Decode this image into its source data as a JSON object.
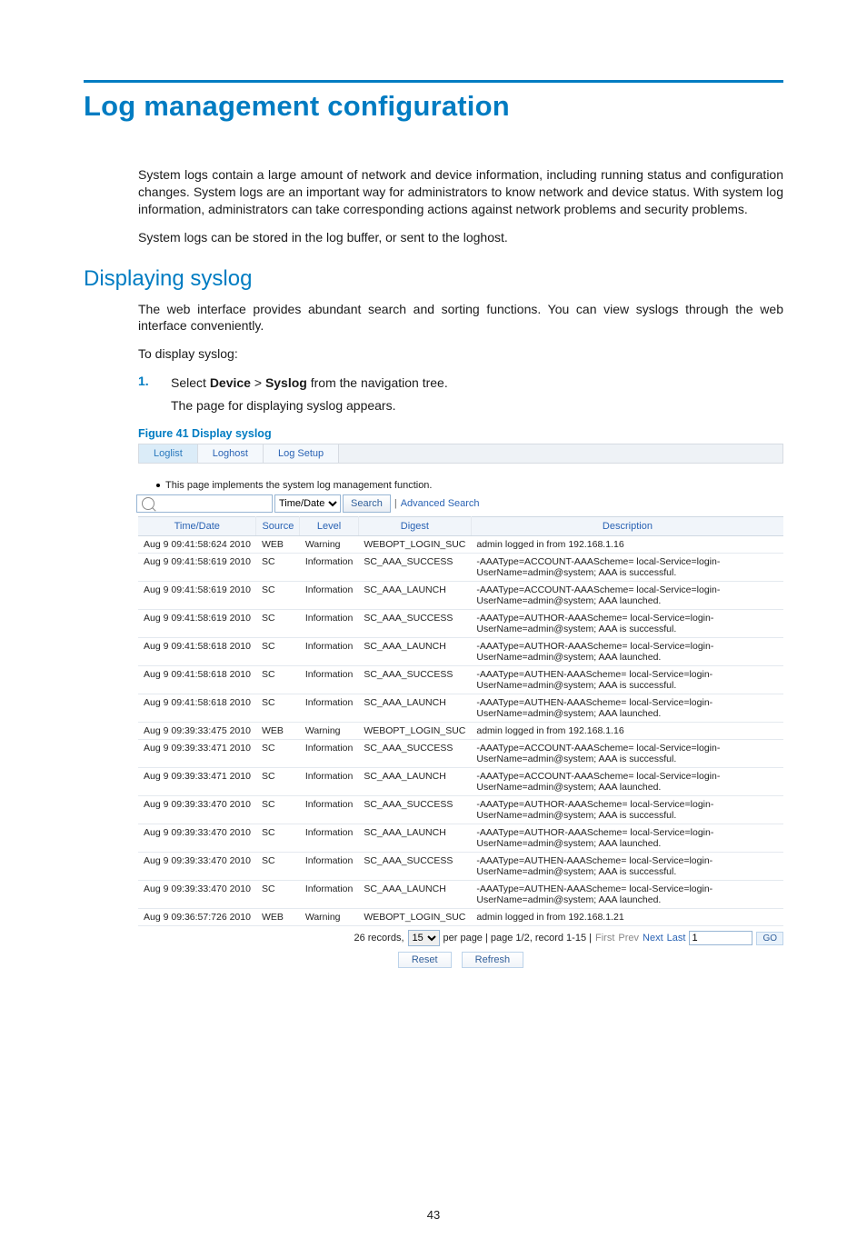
{
  "page_number": "43",
  "title": "Log management configuration",
  "intro_paragraphs": [
    "System logs contain a large amount of network and device information, including running status and configuration changes. System logs are an important way for administrators to know network and device status. With system log information, administrators can take corresponding actions against network problems and security problems.",
    "System logs can be stored in the log buffer, or sent to the loghost."
  ],
  "section_heading": "Displaying syslog",
  "section_paragraphs": [
    "The web interface provides abundant search and sorting functions. You can view syslogs through the web interface conveniently.",
    "To display syslog:"
  ],
  "step": {
    "num": "1.",
    "prefix": "Select ",
    "bold1": "Device",
    "gt": " > ",
    "bold2": "Syslog",
    "suffix": " from the navigation tree.",
    "subtext": "The page for displaying syslog appears."
  },
  "figure_caption": "Figure 41 Display syslog",
  "ui": {
    "tabs": {
      "loglist": "Loglist",
      "loghost": "Loghost",
      "log_setup": "Log Setup"
    },
    "note": "This page implements the system log management function.",
    "search": {
      "value": "",
      "criteria": "Time/Date",
      "button": "Search",
      "advanced": "Advanced Search"
    },
    "columns": {
      "time": "Time/Date",
      "source": "Source",
      "level": "Level",
      "digest": "Digest",
      "description": "Description"
    },
    "rows": [
      {
        "time": "Aug  9 09:41:58:624 2010",
        "source": "WEB",
        "level": "Warning",
        "digest": "WEBOPT_LOGIN_SUC",
        "description": "admin logged in from 192.168.1.16"
      },
      {
        "time": "Aug  9 09:41:58:619 2010",
        "source": "SC",
        "level": "Information",
        "digest": "SC_AAA_SUCCESS",
        "description": "-AAAType=ACCOUNT-AAAScheme= local-Service=login-UserName=admin@system; AAA is successful."
      },
      {
        "time": "Aug  9 09:41:58:619 2010",
        "source": "SC",
        "level": "Information",
        "digest": "SC_AAA_LAUNCH",
        "description": "-AAAType=ACCOUNT-AAAScheme= local-Service=login-UserName=admin@system; AAA launched."
      },
      {
        "time": "Aug  9 09:41:58:619 2010",
        "source": "SC",
        "level": "Information",
        "digest": "SC_AAA_SUCCESS",
        "description": "-AAAType=AUTHOR-AAAScheme= local-Service=login-UserName=admin@system; AAA is successful."
      },
      {
        "time": "Aug  9 09:41:58:618 2010",
        "source": "SC",
        "level": "Information",
        "digest": "SC_AAA_LAUNCH",
        "description": "-AAAType=AUTHOR-AAAScheme= local-Service=login-UserName=admin@system; AAA launched."
      },
      {
        "time": "Aug  9 09:41:58:618 2010",
        "source": "SC",
        "level": "Information",
        "digest": "SC_AAA_SUCCESS",
        "description": "-AAAType=AUTHEN-AAAScheme= local-Service=login-UserName=admin@system; AAA is successful."
      },
      {
        "time": "Aug  9 09:41:58:618 2010",
        "source": "SC",
        "level": "Information",
        "digest": "SC_AAA_LAUNCH",
        "description": "-AAAType=AUTHEN-AAAScheme= local-Service=login-UserName=admin@system; AAA launched."
      },
      {
        "time": "Aug  9 09:39:33:475 2010",
        "source": "WEB",
        "level": "Warning",
        "digest": "WEBOPT_LOGIN_SUC",
        "description": "admin logged in from 192.168.1.16"
      },
      {
        "time": "Aug  9 09:39:33:471 2010",
        "source": "SC",
        "level": "Information",
        "digest": "SC_AAA_SUCCESS",
        "description": "-AAAType=ACCOUNT-AAAScheme= local-Service=login-UserName=admin@system; AAA is successful."
      },
      {
        "time": "Aug  9 09:39:33:471 2010",
        "source": "SC",
        "level": "Information",
        "digest": "SC_AAA_LAUNCH",
        "description": "-AAAType=ACCOUNT-AAAScheme= local-Service=login-UserName=admin@system; AAA launched."
      },
      {
        "time": "Aug  9 09:39:33:470 2010",
        "source": "SC",
        "level": "Information",
        "digest": "SC_AAA_SUCCESS",
        "description": "-AAAType=AUTHOR-AAAScheme= local-Service=login-UserName=admin@system; AAA is successful."
      },
      {
        "time": "Aug  9 09:39:33:470 2010",
        "source": "SC",
        "level": "Information",
        "digest": "SC_AAA_LAUNCH",
        "description": "-AAAType=AUTHOR-AAAScheme= local-Service=login-UserName=admin@system; AAA launched."
      },
      {
        "time": "Aug  9 09:39:33:470 2010",
        "source": "SC",
        "level": "Information",
        "digest": "SC_AAA_SUCCESS",
        "description": "-AAAType=AUTHEN-AAAScheme= local-Service=login-UserName=admin@system; AAA is successful."
      },
      {
        "time": "Aug  9 09:39:33:470 2010",
        "source": "SC",
        "level": "Information",
        "digest": "SC_AAA_LAUNCH",
        "description": "-AAAType=AUTHEN-AAAScheme= local-Service=login-UserName=admin@system; AAA launched."
      },
      {
        "time": "Aug  9 09:36:57:726 2010",
        "source": "WEB",
        "level": "Warning",
        "digest": "WEBOPT_LOGIN_SUC",
        "description": "admin logged in from 192.168.1.21"
      }
    ],
    "pager": {
      "records_prefix": "26 records,",
      "per_page_value": "15",
      "per_page_suffix": "per page | page 1/2, record 1-15 |",
      "first": "First",
      "prev": "Prev",
      "next": "Next",
      "last": "Last",
      "page_value": "1",
      "go": "GO"
    },
    "buttons": {
      "reset": "Reset",
      "refresh": "Refresh"
    }
  }
}
